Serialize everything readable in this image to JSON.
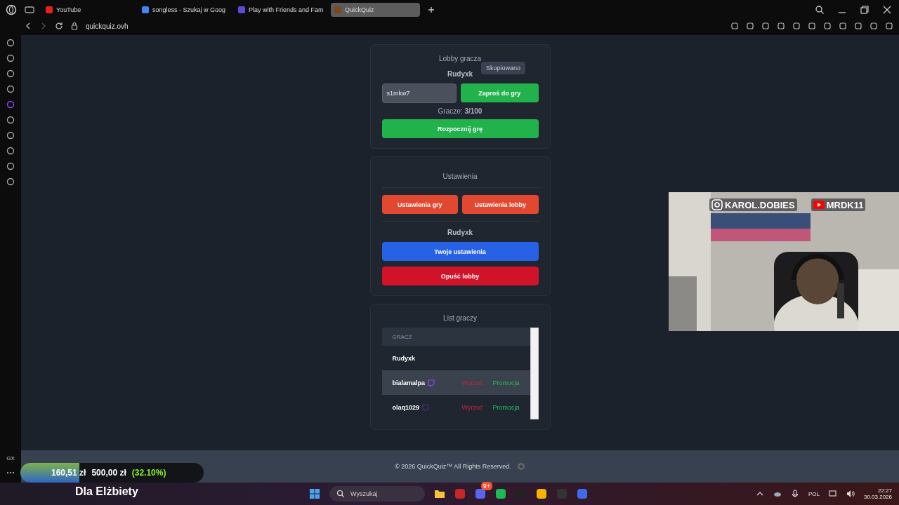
{
  "browser": {
    "tabs": [
      {
        "title": "YouTube",
        "kind": "youtube",
        "selected": false
      },
      {
        "title": "songless - Szukaj w Goog",
        "kind": "google",
        "selected": false
      },
      {
        "title": "Play with Friends and Fam",
        "kind": "purple",
        "selected": false
      },
      {
        "title": "QuickQuiz",
        "kind": "quiz",
        "selected": true
      }
    ],
    "address": "quickquiz.ovh",
    "sidebar_label": "GX"
  },
  "lobby": {
    "title": "Lobby gracza",
    "owner": "Rudyxk",
    "tooltip": "Skopiowano",
    "code": "s1mkw7",
    "invite_button": "Zaproś do gry",
    "players": "Gracze: **3/100**",
    "start_button": "Rozpocznij grę"
  },
  "settings": {
    "title": "Ustawienia",
    "game_settings_button": "Ustawienia gry",
    "lobby_settings_button": "Ustawienia lobby",
    "user": "Rudyxk",
    "your_settings_button": "Twoje ustawienia",
    "leave_button": "Opuść lobby"
  },
  "player_list": {
    "title": "List graczy",
    "column": "GRACZ",
    "rows": [
      {
        "name": "Rudyxk",
        "twitch": false,
        "selected": false
      },
      {
        "name": "bialamalpa",
        "twitch": true,
        "selected": true,
        "kick": "Wyrzuć",
        "promote": "Promocja"
      },
      {
        "name": "olaq1029",
        "twitch": true,
        "selected": false,
        "kick": "Wyrzuć",
        "promote": "Promocja"
      }
    ]
  },
  "footer": {
    "text": "© 2026  QuickQuiz™ All Rights Reserved."
  },
  "overlay": {
    "donation": {
      "amount": "160,51 zł",
      "goal": "500,00 zł",
      "percent": "(32.10%)",
      "level": 0.321
    },
    "dedication": "Dla Elżbiety",
    "webcam": {
      "kind": "picture",
      "instagram": "KAROL.DOBIES",
      "youtube": "MRDK11"
    }
  },
  "taskbar": {
    "search_placeholder": "Wyszukaj",
    "discord_badge": "9+",
    "language": "POL",
    "time": "22:27",
    "date": "30.03.2026"
  }
}
